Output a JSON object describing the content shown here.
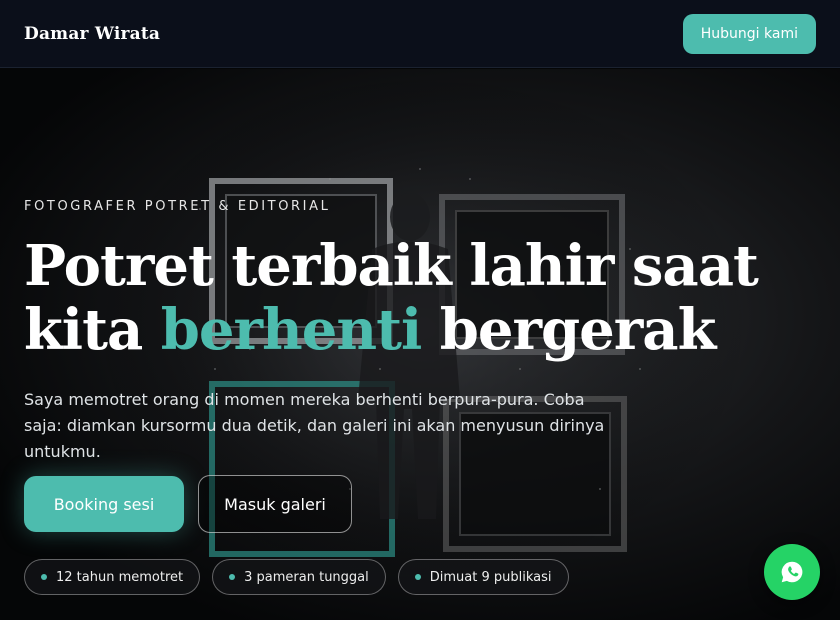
{
  "nav": {
    "brand": "Damar Wirata",
    "contact_label": "Hubungi kami"
  },
  "hero": {
    "eyebrow": "FOTOGRAFER POTRET & EDITORIAL",
    "headline_line1": "Potret terbaik lahir saat",
    "headline_pre": "kita ",
    "headline_accent": "berhenti",
    "headline_post": " bergerak",
    "subtitle": "Saya memotret orang di momen mereka berhenti berpura-pura. Coba saja: diamkan kursormu dua detik, dan galeri ini akan menyusun dirinya untukmu.",
    "primary_cta": "Booking sesi",
    "secondary_cta": "Masuk galeri",
    "stats": [
      "12 tahun memotret",
      "3 pameran tunggal",
      "Dimuat 9 publikasi"
    ]
  },
  "floating": {
    "icon": "whatsapp-icon"
  },
  "colors": {
    "accent": "#4dbcae",
    "whatsapp": "#25d366",
    "nav_bg": "#0b0f1a"
  }
}
